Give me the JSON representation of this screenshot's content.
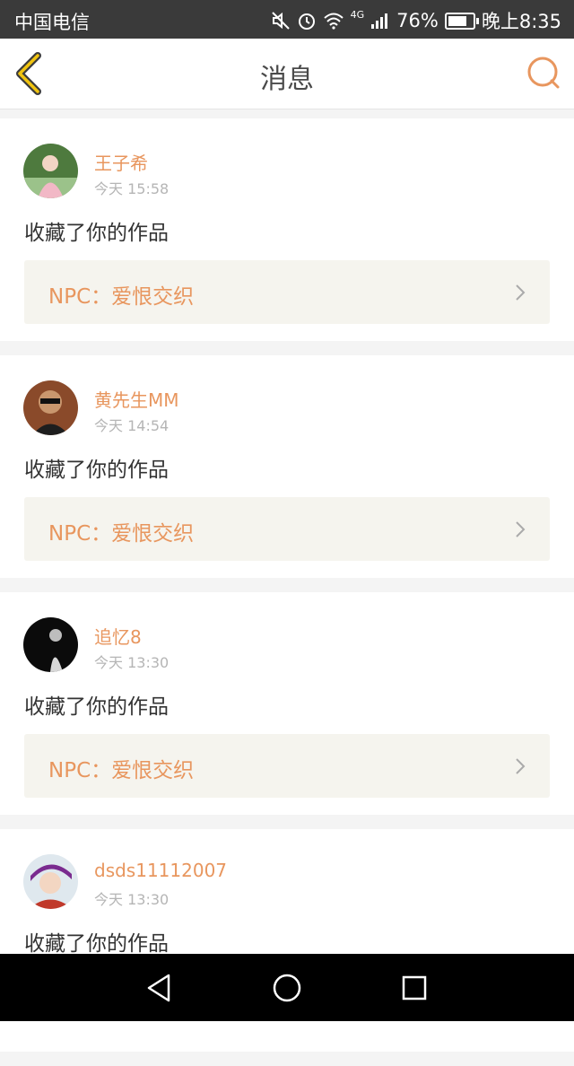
{
  "status_bar": {
    "carrier": "中国电信",
    "network": "4G",
    "battery": "76%",
    "battery_level": 0.76,
    "time": "晚上8:35",
    "icons": [
      "mute-icon",
      "alarm-icon",
      "wifi-icon",
      "signal-icon",
      "battery-icon"
    ]
  },
  "header": {
    "title": "消息",
    "back_icon": "back-chevron-icon",
    "search_icon": "search-icon"
  },
  "messages": [
    {
      "username": "王子希",
      "time": "今天 15:58",
      "action": "收藏了你的作品",
      "work_title": "NPC：爱恨交织"
    },
    {
      "username": "黄先生MM",
      "time": "今天 14:54",
      "action": "收藏了你的作品",
      "work_title": "NPC：爱恨交织"
    },
    {
      "username": "追忆8",
      "time": "今天 13:30",
      "action": "收藏了你的作品",
      "work_title": "NPC：爱恨交织"
    },
    {
      "username": "dsds11112007",
      "time": "今天 13:30",
      "action": "收藏了你的作品"
    }
  ],
  "colors": {
    "accent": "#e8965e",
    "status_bar_bg": "#3a3a3a",
    "card_bg": "#ffffff",
    "work_bg": "#f5f4ee",
    "page_bg": "#f4f4f4"
  },
  "system_nav": [
    "back-triangle-icon",
    "home-circle-icon",
    "recents-square-icon"
  ]
}
